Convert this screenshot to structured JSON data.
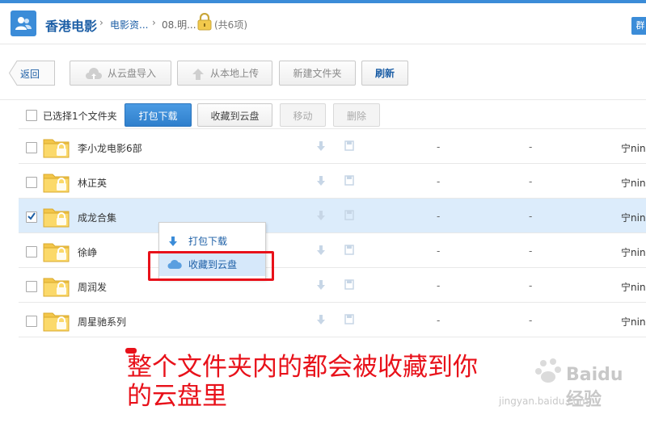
{
  "header": {
    "share_name": "香港电影",
    "crumbs": [
      "电影资...",
      "08.明..."
    ],
    "count": "(共6项)",
    "corner_button": "群"
  },
  "toolbar": {
    "back": "返回",
    "import_cloud": "从云盘导入",
    "upload_local": "从本地上传",
    "new_folder": "新建文件夹",
    "refresh": "刷新"
  },
  "selection_bar": {
    "selected_text": "已选择1个文件夹",
    "download_pack": "打包下载",
    "save_to_cloud": "收藏到云盘",
    "move": "移动",
    "delete": "删除"
  },
  "files": [
    {
      "name": "李小龙电影6部",
      "col2": "-",
      "col3": "-",
      "owner": "宁ning",
      "checked": false
    },
    {
      "name": "林正英",
      "col2": "-",
      "col3": "-",
      "owner": "宁ning",
      "checked": false
    },
    {
      "name": "成龙合集",
      "col2": "-",
      "col3": "-",
      "owner": "宁ning",
      "checked": true
    },
    {
      "name": "徐峥",
      "col2": "-",
      "col3": "-",
      "owner": "宁ning",
      "checked": false
    },
    {
      "name": "周润发",
      "col2": "-",
      "col3": "-",
      "owner": "宁ning",
      "checked": false
    },
    {
      "name": "周星驰系列",
      "col2": "-",
      "col3": "-",
      "owner": "宁ning",
      "checked": false
    }
  ],
  "context_menu": {
    "download_pack": "打包下载",
    "save_to_cloud": "收藏到云盘"
  },
  "annotation": {
    "line1": "整个文件夹内的都会被收藏到你",
    "line2": "的云盘里"
  },
  "watermark": {
    "text": "Baidu 经验",
    "url": "jingyan.baidu.com"
  },
  "colors": {
    "accent": "#3b8cd8",
    "selected_row": "#dcecfb",
    "annotation_red": "#e8111a"
  }
}
